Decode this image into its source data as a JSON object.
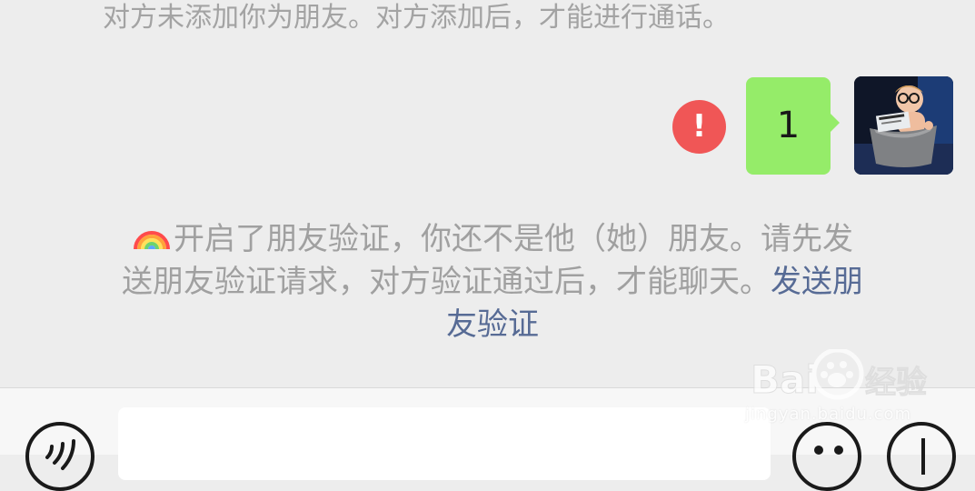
{
  "chat": {
    "top_notice": "对方未添加你为朋友。对方添加后，才能进行通话。",
    "message_text": "1",
    "error_symbol": "!",
    "friend_verification_line1": "开启了朋友验证，你还不是他（她）朋友。请先发",
    "friend_verification_line2_prefix": "送朋友验证请求，对方验证通过后，才能聊天。",
    "friend_verification_link_part1": "发送朋",
    "friend_verification_link_part2": "友验证",
    "rainbow_icon": "rainbow-emoji-icon"
  },
  "input_bar": {
    "voice_icon": "voice-input-icon",
    "emoji_icon": "emoji-icon",
    "more_icon": "more-options-icon",
    "input_value": ""
  },
  "watermark": {
    "logo_text": "Baidu经验",
    "domain": "jingyan.baidu.com"
  },
  "colors": {
    "background": "#ededed",
    "system_text": "#a3a3a3",
    "link_text": "#576b95",
    "sent_bubble": "#95ec69",
    "error_red": "#f05656",
    "input_bar_bg": "#f7f7f7"
  }
}
